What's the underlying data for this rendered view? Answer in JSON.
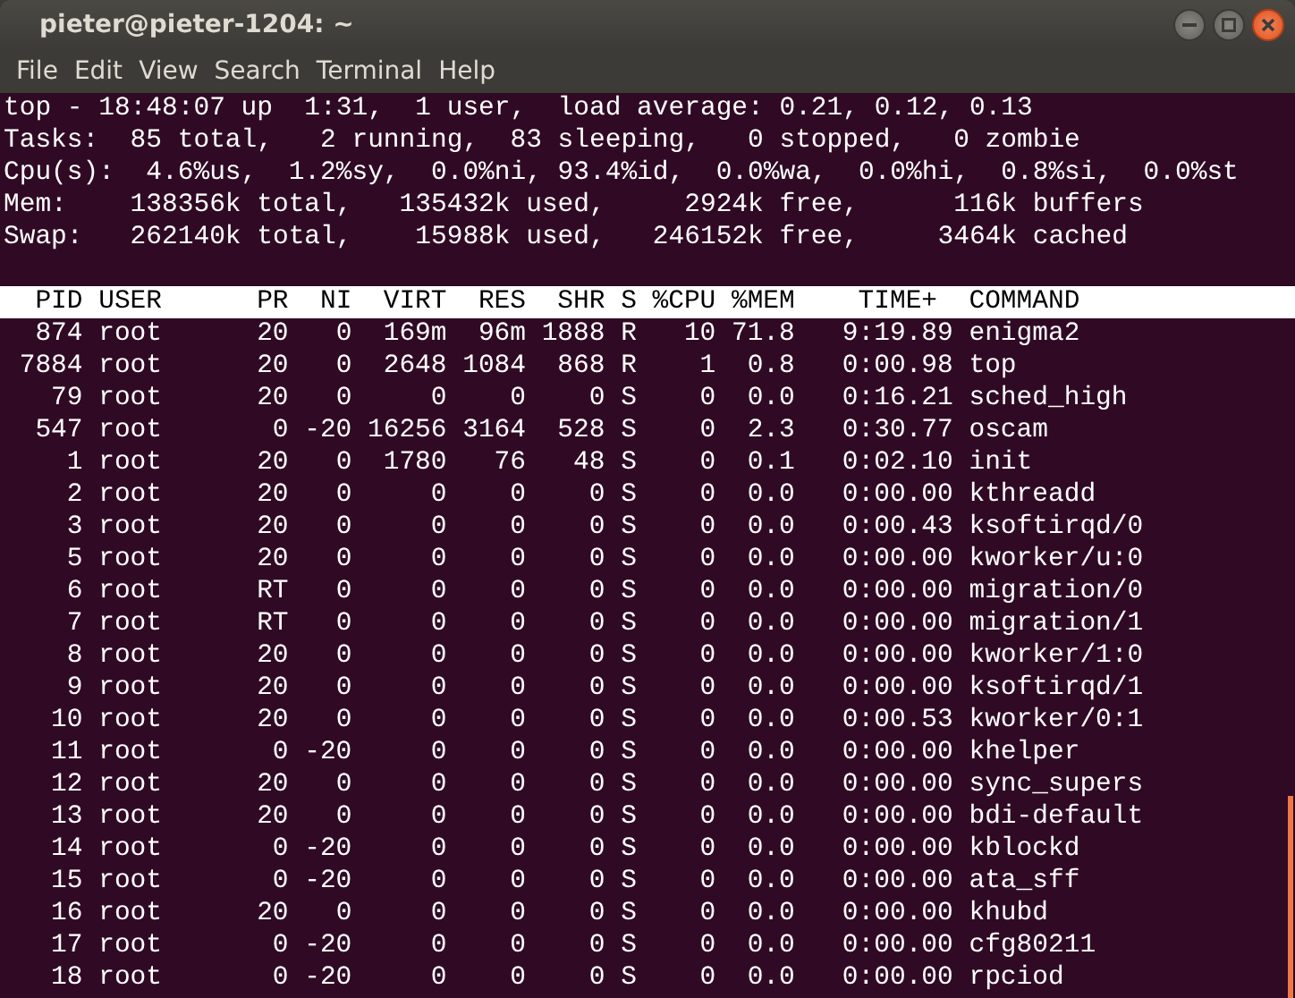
{
  "window": {
    "title": "pieter@pieter-1204: ~",
    "controls": [
      {
        "kind": "minimize"
      },
      {
        "kind": "maximize"
      },
      {
        "kind": "close"
      }
    ]
  },
  "menu": [
    "File",
    "Edit",
    "View",
    "Search",
    "Terminal",
    "Help"
  ],
  "summary": [
    "top - 18:48:07 up  1:31,  1 user,  load average: 0.21, 0.12, 0.13",
    "Tasks:  85 total,   2 running,  83 sleeping,   0 stopped,   0 zombie",
    "Cpu(s):  4.6%us,  1.2%sy,  0.0%ni, 93.4%id,  0.0%wa,  0.0%hi,  0.8%si,  0.0%st",
    "Mem:    138356k total,   135432k used,     2924k free,      116k buffers",
    "Swap:   262140k total,    15988k used,   246152k free,     3464k cached"
  ],
  "table": {
    "columns": [
      "PID",
      "USER",
      "PR",
      "NI",
      "VIRT",
      "RES",
      "SHR",
      "S",
      "%CPU",
      "%MEM",
      "TIME+",
      "COMMAND"
    ],
    "rows": [
      [
        "874",
        "root",
        "20",
        "0",
        "169m",
        "96m",
        "1888",
        "R",
        "10",
        "71.8",
        "9:19.89",
        "enigma2"
      ],
      [
        "7884",
        "root",
        "20",
        "0",
        "2648",
        "1084",
        "868",
        "R",
        "1",
        "0.8",
        "0:00.98",
        "top"
      ],
      [
        "79",
        "root",
        "20",
        "0",
        "0",
        "0",
        "0",
        "S",
        "0",
        "0.0",
        "0:16.21",
        "sched_high"
      ],
      [
        "547",
        "root",
        "0",
        "-20",
        "16256",
        "3164",
        "528",
        "S",
        "0",
        "2.3",
        "0:30.77",
        "oscam"
      ],
      [
        "1",
        "root",
        "20",
        "0",
        "1780",
        "76",
        "48",
        "S",
        "0",
        "0.1",
        "0:02.10",
        "init"
      ],
      [
        "2",
        "root",
        "20",
        "0",
        "0",
        "0",
        "0",
        "S",
        "0",
        "0.0",
        "0:00.00",
        "kthreadd"
      ],
      [
        "3",
        "root",
        "20",
        "0",
        "0",
        "0",
        "0",
        "S",
        "0",
        "0.0",
        "0:00.43",
        "ksoftirqd/0"
      ],
      [
        "5",
        "root",
        "20",
        "0",
        "0",
        "0",
        "0",
        "S",
        "0",
        "0.0",
        "0:00.00",
        "kworker/u:0"
      ],
      [
        "6",
        "root",
        "RT",
        "0",
        "0",
        "0",
        "0",
        "S",
        "0",
        "0.0",
        "0:00.00",
        "migration/0"
      ],
      [
        "7",
        "root",
        "RT",
        "0",
        "0",
        "0",
        "0",
        "S",
        "0",
        "0.0",
        "0:00.00",
        "migration/1"
      ],
      [
        "8",
        "root",
        "20",
        "0",
        "0",
        "0",
        "0",
        "S",
        "0",
        "0.0",
        "0:00.00",
        "kworker/1:0"
      ],
      [
        "9",
        "root",
        "20",
        "0",
        "0",
        "0",
        "0",
        "S",
        "0",
        "0.0",
        "0:00.00",
        "ksoftirqd/1"
      ],
      [
        "10",
        "root",
        "20",
        "0",
        "0",
        "0",
        "0",
        "S",
        "0",
        "0.0",
        "0:00.53",
        "kworker/0:1"
      ],
      [
        "11",
        "root",
        "0",
        "-20",
        "0",
        "0",
        "0",
        "S",
        "0",
        "0.0",
        "0:00.00",
        "khelper"
      ],
      [
        "12",
        "root",
        "20",
        "0",
        "0",
        "0",
        "0",
        "S",
        "0",
        "0.0",
        "0:00.00",
        "sync_supers"
      ],
      [
        "13",
        "root",
        "20",
        "0",
        "0",
        "0",
        "0",
        "S",
        "0",
        "0.0",
        "0:00.00",
        "bdi-default"
      ],
      [
        "14",
        "root",
        "0",
        "-20",
        "0",
        "0",
        "0",
        "S",
        "0",
        "0.0",
        "0:00.00",
        "kblockd"
      ],
      [
        "15",
        "root",
        "0",
        "-20",
        "0",
        "0",
        "0",
        "S",
        "0",
        "0.0",
        "0:00.00",
        "ata_sff"
      ],
      [
        "16",
        "root",
        "20",
        "0",
        "0",
        "0",
        "0",
        "S",
        "0",
        "0.0",
        "0:00.00",
        "khubd"
      ],
      [
        "17",
        "root",
        "0",
        "-20",
        "0",
        "0",
        "0",
        "S",
        "0",
        "0.0",
        "0:00.00",
        "cfg80211"
      ],
      [
        "18",
        "root",
        "0",
        "-20",
        "0",
        "0",
        "0",
        "S",
        "0",
        "0.0",
        "0:00.00",
        "rpciod"
      ]
    ]
  }
}
